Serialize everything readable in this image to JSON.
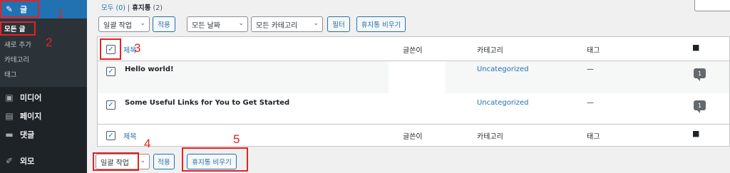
{
  "sidebar": {
    "posts": {
      "label": "글",
      "icon": "pin-icon"
    },
    "sub_items": [
      {
        "label": "모든 글"
      },
      {
        "label": "새로 추가"
      },
      {
        "label": "카테고리"
      },
      {
        "label": "태그"
      }
    ],
    "menu": [
      {
        "label": "미디어",
        "icon": "media-icon"
      },
      {
        "label": "페이지",
        "icon": "page-icon"
      },
      {
        "label": "댓글",
        "icon": "comment-icon"
      },
      {
        "label": "외모",
        "icon": "brush-icon"
      }
    ]
  },
  "filters": {
    "all": "모두 (0)",
    "separator": "|",
    "trash": "휴지통",
    "trash_count": "(2)"
  },
  "top_actions": {
    "bulk_action": "일괄 작업",
    "apply": "적용",
    "all_dates": "모든 날짜",
    "all_categories": "모든 카테고리",
    "filter": "필터",
    "empty_trash": "휴지통 비우기"
  },
  "table": {
    "columns": {
      "title": "제목",
      "author": "글쓴이",
      "categories": "카테고리",
      "tags": "태그"
    },
    "rows": [
      {
        "title": "Hello world!",
        "category": "Uncategorized",
        "tags": "—",
        "comments": "1"
      },
      {
        "title": "Some Useful Links for You to Get Started",
        "category": "Uncategorized",
        "tags": "—",
        "comments": "1"
      }
    ]
  },
  "bottom_actions": {
    "bulk_action": "일괄 작업",
    "apply": "적용",
    "empty_trash": "휴지통 비우기"
  },
  "annotations": [
    "1",
    "2",
    "3",
    "4",
    "5"
  ],
  "colors": {
    "highlight": "#e02424",
    "link": "#2271b1",
    "sidebar": "#1d2327",
    "current_menu": "#2271b1"
  }
}
